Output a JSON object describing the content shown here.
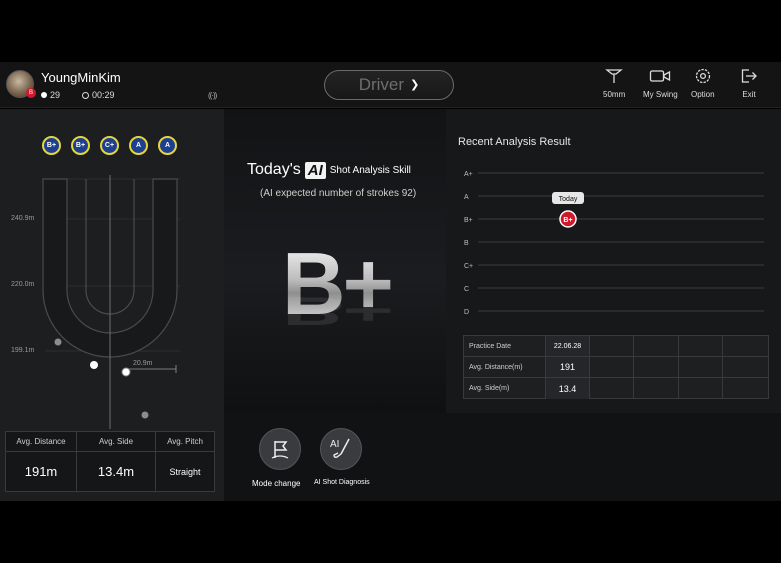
{
  "user": {
    "name": "YoungMinKim",
    "badge": "B",
    "balls": "29",
    "time": "00:29",
    "signal": "((·))"
  },
  "club": {
    "selected": "Driver"
  },
  "toolbar": [
    {
      "label": "50mm",
      "icon": "tee-height-icon"
    },
    {
      "label": "My Swing",
      "icon": "video-camera-icon"
    },
    {
      "label": "Option",
      "icon": "gear-icon"
    },
    {
      "label": "Exit",
      "icon": "exit-icon"
    }
  ],
  "shot_map": {
    "grades": [
      "B+",
      "B+",
      "C+",
      "A",
      "A"
    ],
    "distance_labels": [
      "240.9m",
      "220.0m",
      "199.1m"
    ],
    "side_label": "20.9m"
  },
  "stats": {
    "headers": [
      "Avg. Distance",
      "Avg. Side",
      "Avg. Pitch"
    ],
    "values": [
      "191m",
      "13.4m",
      "Straight"
    ]
  },
  "analysis": {
    "title_prefix": "Today's",
    "ai_badge": "AI",
    "title_suffix": "Shot Analysis Skill",
    "expected": "(AI expected number of strokes 92)",
    "grade": "B+"
  },
  "recent": {
    "title": "Recent Analysis Result",
    "today_tag": "Today"
  },
  "chart_data": {
    "type": "scatter",
    "title": "Recent Analysis Result",
    "y_categories": [
      "A+",
      "A",
      "B+",
      "B",
      "C+",
      "C",
      "D"
    ],
    "points": [
      {
        "label": "Today",
        "value": "B+"
      }
    ]
  },
  "practice": {
    "rows": [
      {
        "label": "Practice Date",
        "value": "22.06.28"
      },
      {
        "label": "Avg. Distance(m)",
        "value": "191"
      },
      {
        "label": "Avg. Side(m)",
        "value": "13.4"
      }
    ]
  },
  "actions": [
    {
      "label": "Mode change",
      "icon": "flag-icon"
    },
    {
      "label": "AI Shot Diagnosis",
      "icon": "ai-club-icon"
    }
  ],
  "colors": {
    "accent_red": "#d0172b",
    "grade_blue": "#1c3f8f",
    "grade_ring": "#e6d53a"
  }
}
